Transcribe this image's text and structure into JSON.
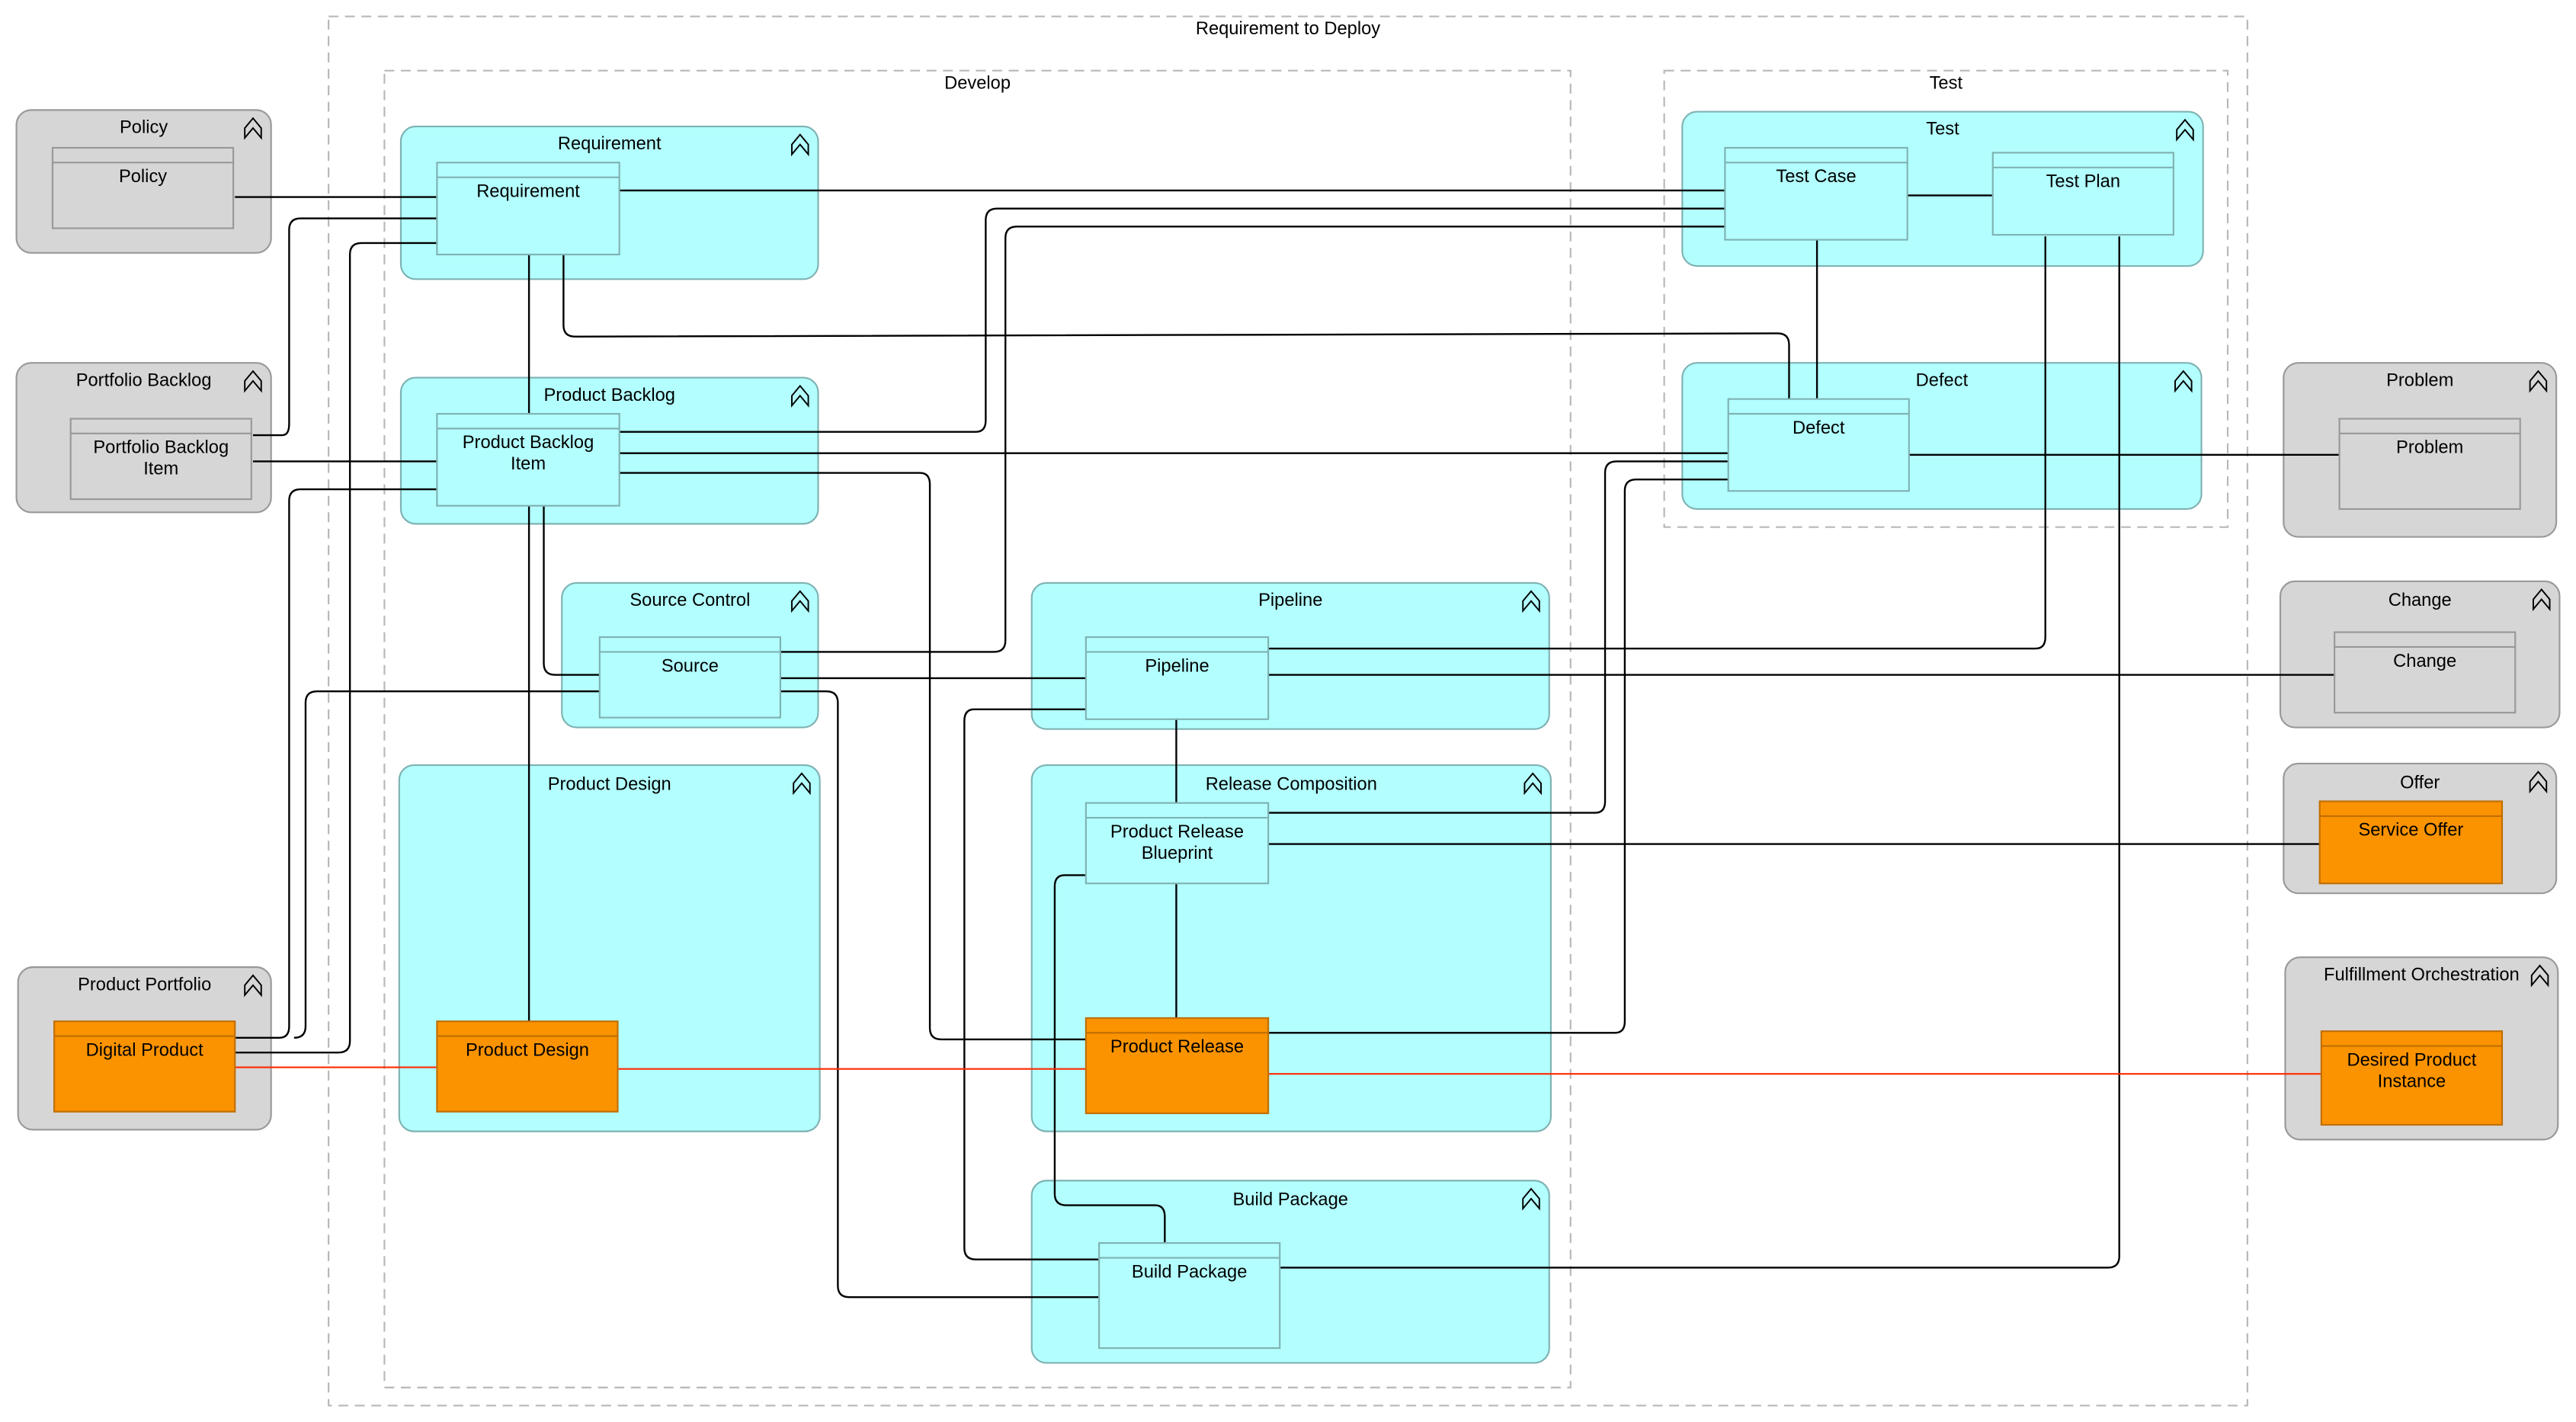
{
  "frames": {
    "outer": "Requirement to Deploy",
    "develop": "Develop",
    "test": "Test"
  },
  "groups": {
    "policy": "Policy",
    "portfolio_backlog": "Portfolio Backlog",
    "product_portfolio": "Product Portfolio",
    "requirement": "Requirement",
    "product_backlog": "Product Backlog",
    "source_control": "Source Control",
    "product_design": "Product Design",
    "pipeline": "Pipeline",
    "release_composition": "Release Composition",
    "build_package": "Build Package",
    "test": "Test",
    "defect": "Defect",
    "problem": "Problem",
    "change": "Change",
    "offer": "Offer",
    "fulfillment_orchestration": "Fulfillment Orchestration"
  },
  "entities": {
    "policy": [
      "Policy"
    ],
    "portfolio_backlog_item": [
      "Portfolio Backlog",
      "Item"
    ],
    "digital_product": [
      "Digital Product"
    ],
    "requirement": [
      "Requirement"
    ],
    "product_backlog_item": [
      "Product Backlog",
      "Item"
    ],
    "source": [
      "Source"
    ],
    "product_design": [
      "Product Design"
    ],
    "pipeline": [
      "Pipeline"
    ],
    "product_release_blueprint": [
      "Product Release",
      "Blueprint"
    ],
    "product_release": [
      "Product Release"
    ],
    "build_package": [
      "Build Package"
    ],
    "test_case": [
      "Test Case"
    ],
    "test_plan": [
      "Test Plan"
    ],
    "defect": [
      "Defect"
    ],
    "problem": [
      "Problem"
    ],
    "change": [
      "Change"
    ],
    "service_offer": [
      "Service Offer"
    ],
    "desired_product_instance": [
      "Desired Product",
      "Instance"
    ]
  },
  "colors": {
    "functional_group": "#b3ffff",
    "external_group": "#d6d6d6",
    "key_entity": "#fb9300",
    "system_of_record_line": "#ff2a00",
    "relationship_line": "#000000"
  },
  "icons": {
    "collapse": "collapse-chevron-icon"
  }
}
